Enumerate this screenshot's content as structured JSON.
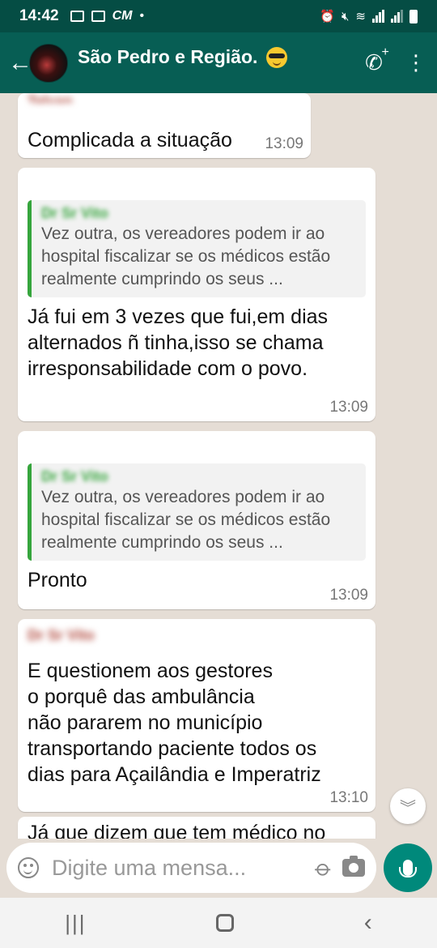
{
  "status_bar": {
    "time": "14:42",
    "carrier_label": "CM"
  },
  "header": {
    "group_name": "São Pedro e Região.",
    "subtitle": "",
    "back_icon": "back-arrow-icon",
    "call_icon": "add-call-icon",
    "menu_icon": "more-vert-icon",
    "colors": {
      "header": "#075e54",
      "status_bar": "#054d44"
    }
  },
  "messages": [
    {
      "sender": "Telvan",
      "text": "Complicada a situação",
      "time": "13:09"
    },
    {
      "sender": "",
      "quote_author": "Dr Sr Vito",
      "quote_text": "Vez outra, os vereadores podem ir ao hospital fiscalizar se os médicos estão realmente cumprindo os seus ...",
      "text": "Já fui em 3 vezes que fui,em dias alternados ñ tinha,isso se chama irresponsabilidade  com o povo.",
      "time": "13:09"
    },
    {
      "sender": "",
      "quote_author": "Dr Sr Vito",
      "quote_text": "Vez outra, os vereadores podem ir ao hospital fiscalizar se os médicos estão realmente cumprindo os seus ...",
      "text": "Pronto",
      "time": "13:09"
    },
    {
      "sender": "Dr Sr Vito",
      "text": "E questionem aos gestores\no porquê das ambulância\nnão pararem no município\ntransportando paciente todos os\ndias para Açailândia e Imperatriz",
      "time": "13:10"
    },
    {
      "text": "Já que dizem que tem médico no"
    }
  ],
  "composer": {
    "placeholder": "Digite uma mensa...",
    "emoji_icon": "emoji-icon",
    "attach_icon": "paperclip-icon",
    "camera_icon": "camera-icon",
    "mic_icon": "mic-icon",
    "accent": "#00897b"
  }
}
